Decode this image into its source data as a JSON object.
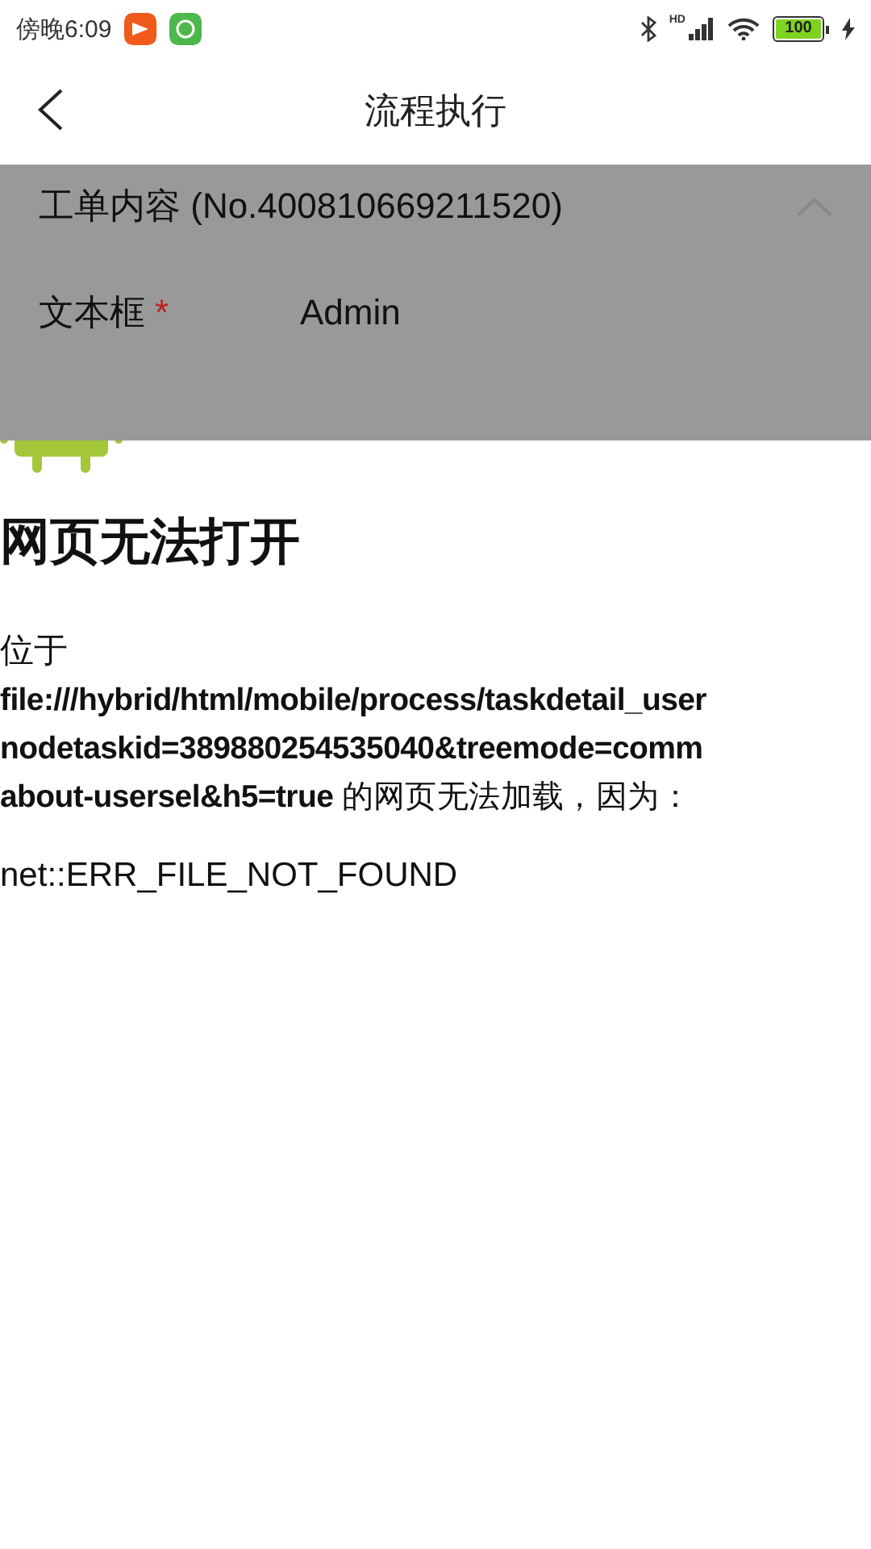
{
  "status_bar": {
    "time": "傍晚6:09",
    "network_label": "HD",
    "battery": "100"
  },
  "nav": {
    "title": "流程执行"
  },
  "panel": {
    "title": "工单内容 (No.400810669211520)",
    "expanded": true,
    "fields": [
      {
        "label": "文本框",
        "required": true,
        "required_mark": "*",
        "value": "Admin"
      }
    ]
  },
  "error_page": {
    "heading": "网页无法打开",
    "lead": "位于",
    "lines": [
      "file:///hybrid/html/mobile/process/taskdetail_user",
      "nodetaskid=389880254535040&treemode=comm",
      "**about-usersel&h5=true** 的网页无法加载，因为："
    ],
    "error_code": "net::ERR_FILE_NOT_FOUND"
  }
}
